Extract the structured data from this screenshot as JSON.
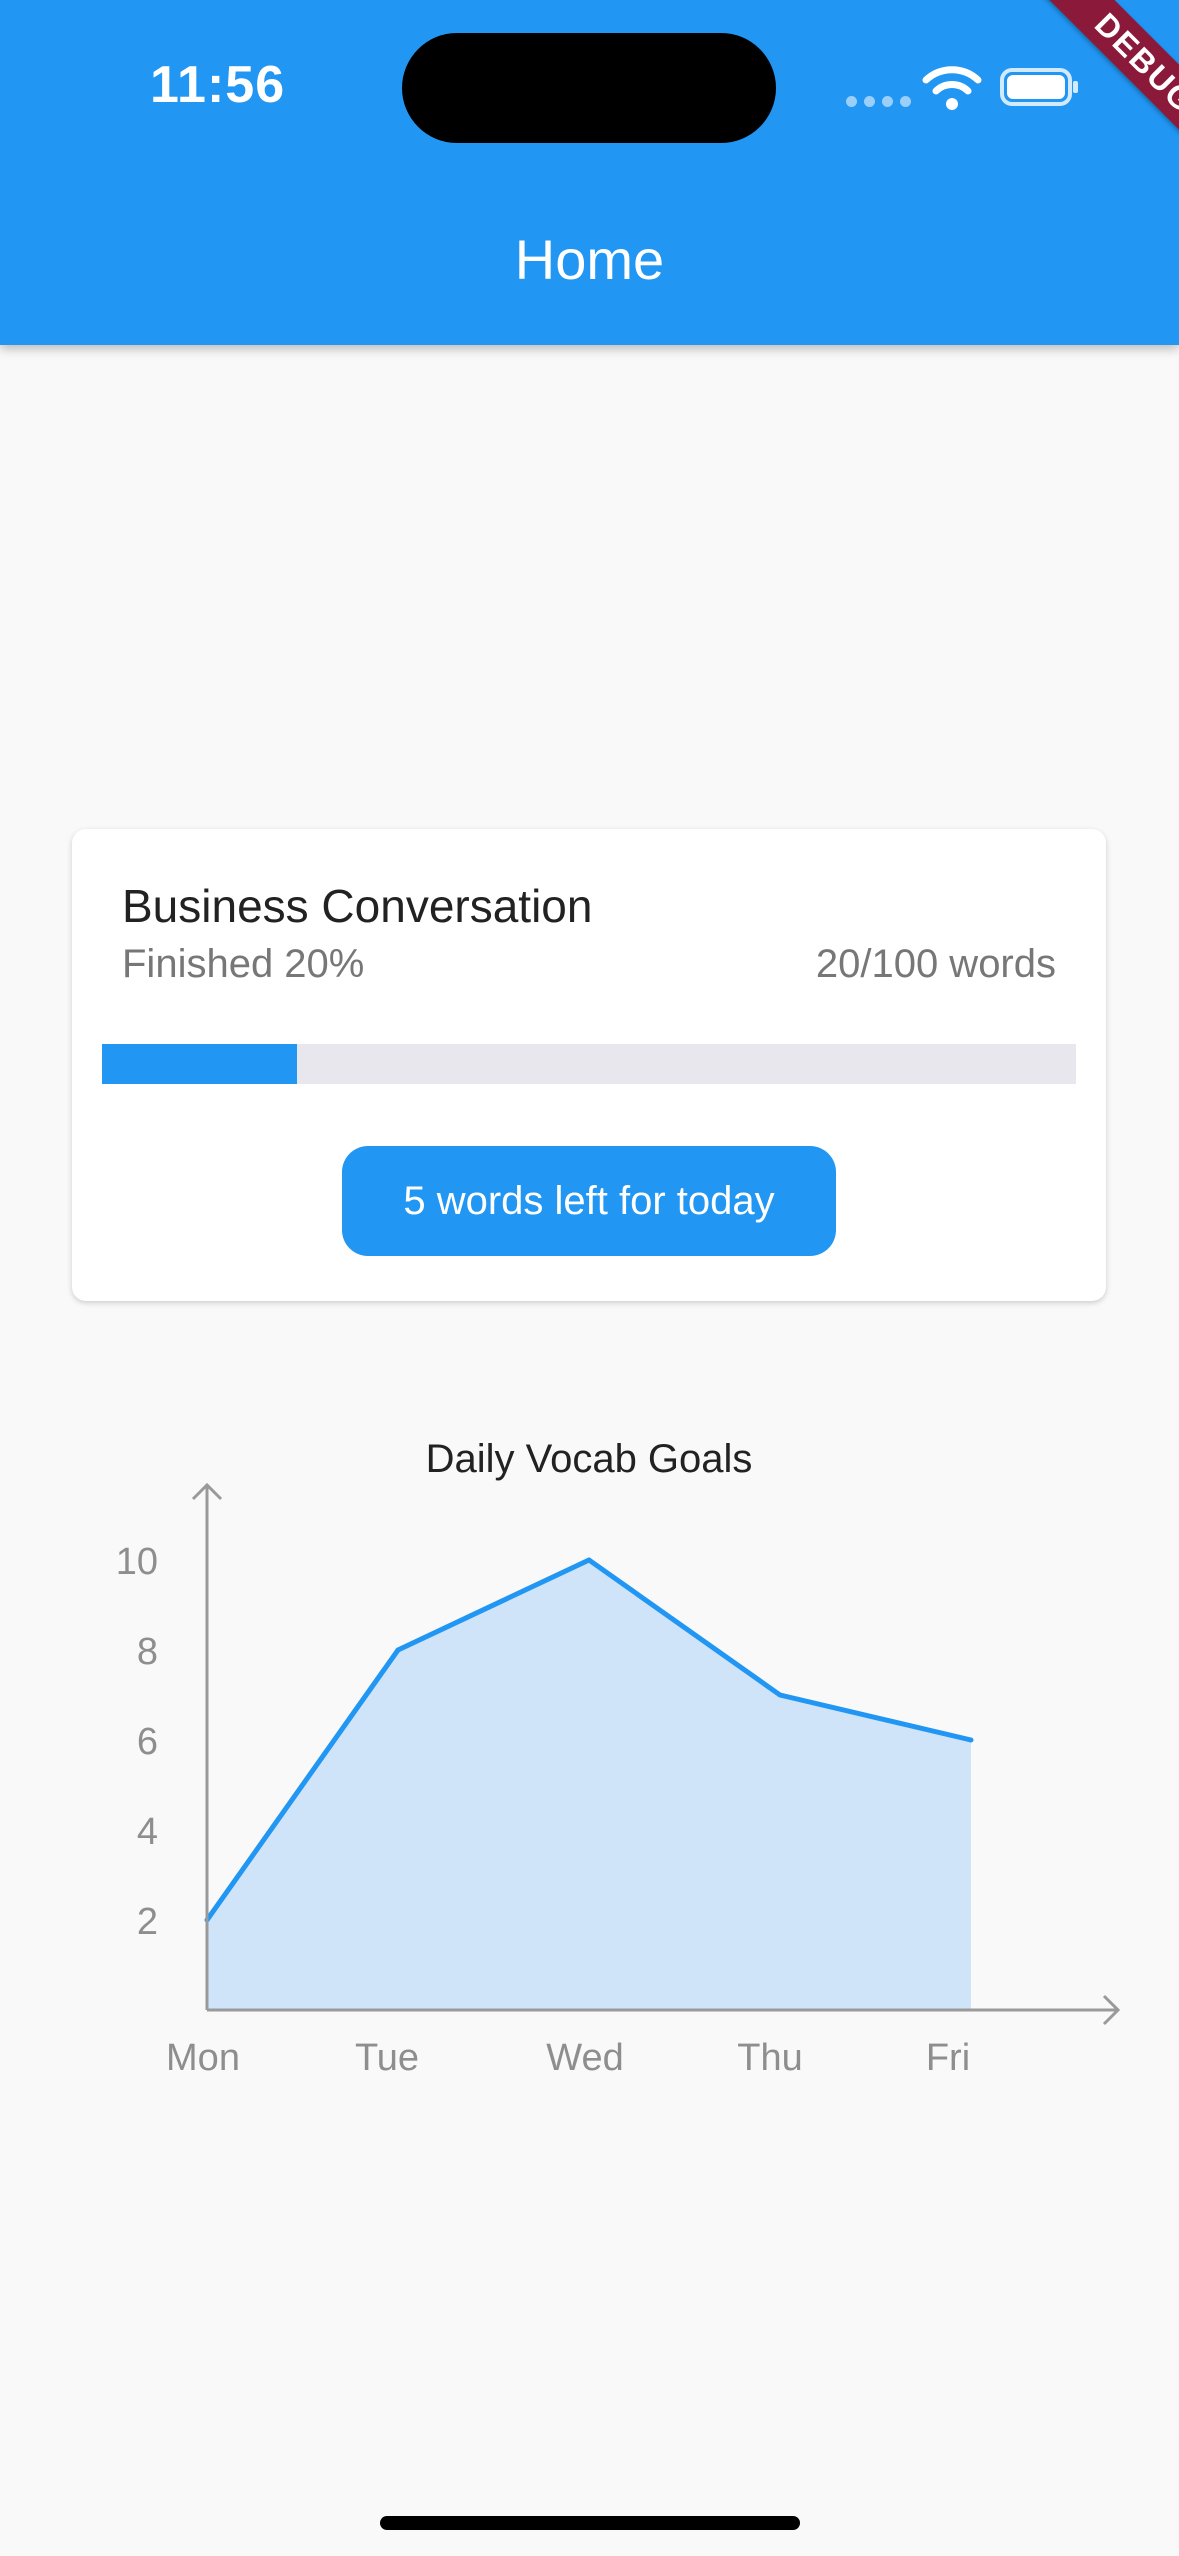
{
  "status_bar": {
    "time": "11:56",
    "debug_label": "DEBUG"
  },
  "app_bar": {
    "title": "Home"
  },
  "card": {
    "title": "Business Conversation",
    "finished_text": "Finished 20%",
    "words_text": "20/100 words",
    "progress_fraction": 0.2,
    "button_label": "5 words left for today"
  },
  "colors": {
    "primary": "#2196f3",
    "area_fill": "#cfe4f8",
    "track": "#e8e7ee",
    "debug": "#8b1a3a"
  },
  "chart_data": {
    "type": "area",
    "title": "Daily Vocab Goals",
    "categories": [
      "Mon",
      "Tue",
      "Wed",
      "Thu",
      "Fri"
    ],
    "series": [
      {
        "values": [
          2,
          8,
          10,
          7,
          6
        ]
      }
    ],
    "y_ticks": [
      "2",
      "4",
      "6",
      "8",
      "10"
    ],
    "ylim": [
      0,
      10
    ],
    "grid": false,
    "legend": "none"
  }
}
